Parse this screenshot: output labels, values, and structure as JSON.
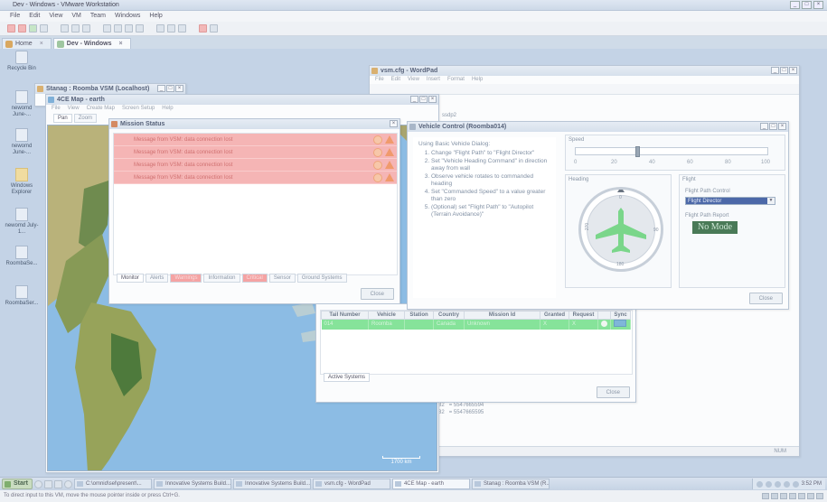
{
  "vmware": {
    "title": "Dev - Windows - VMware Workstation",
    "menu": [
      "File",
      "Edit",
      "View",
      "VM",
      "Team",
      "Windows",
      "Help"
    ],
    "tabs": [
      {
        "label": "Home"
      },
      {
        "label": "Dev - Windows"
      }
    ],
    "status": "To direct input to this VM, move the mouse pointer inside or press Ctrl+G."
  },
  "desktop_icons": [
    {
      "label": "Recycle Bin"
    },
    {
      "label": "newomd June-..."
    },
    {
      "label": "newomd June-..."
    },
    {
      "label": "Windows Explorer"
    },
    {
      "label": "newomd July-1..."
    },
    {
      "label": "RoombaSe..."
    },
    {
      "label": "RoombaSer..."
    }
  ],
  "wordpad": {
    "title": "vsm.cfg - WordPad",
    "menu": [
      "File",
      "Edit",
      "View",
      "Insert",
      "Format",
      "Help"
    ],
    "line1": "ssdp2",
    "line2": "82",
    "line3": "= 5547665594",
    "line4": "82",
    "line5": "= 5547665595",
    "status": "NUM"
  },
  "stanag": {
    "title": "Stanag : Roomba VSM (Localhost)"
  },
  "map_window": {
    "title": "4CE Map - earth",
    "menu": [
      "File",
      "View",
      "Create Map",
      "Screen Setup",
      "Help"
    ],
    "tool_tabs": [
      "Pan",
      "Zoom"
    ],
    "scale": "1700 km"
  },
  "mission_status": {
    "title": "Mission Status",
    "alerts": [
      {
        "text": "Message from VSM: data connection lost"
      },
      {
        "text": "Message from VSM: data connection lost"
      },
      {
        "text": "Message from VSM: data connection lost"
      },
      {
        "text": "Message from VSM: data connection lost"
      }
    ],
    "tabs": [
      {
        "label": "Monitor",
        "state": "sel"
      },
      {
        "label": "Alerts",
        "state": ""
      },
      {
        "label": "Warnings",
        "state": "hl"
      },
      {
        "label": "Information",
        "state": ""
      },
      {
        "label": "Critical",
        "state": "hl"
      },
      {
        "label": "Sensor",
        "state": ""
      },
      {
        "label": "Ground Systems",
        "state": ""
      }
    ],
    "close": "Close"
  },
  "vehicle_control": {
    "title": "Vehicle Control (Roomba014)",
    "intro": "Using Basic Vehicle Dialog:",
    "steps": [
      "Change \"Flight Path\" to \"Flight Director\"",
      "Set \"Vehicle Heading Command\" in direction away from wall",
      "Observe vehicle rotates to commanded heading",
      "Set \"Commanded Speed\" to a value greater than zero",
      "(Optional) set \"Flight Path\" to \"Autopilot (Terrain Avoidance)\""
    ],
    "speed_label": "Speed",
    "speed_ticks": [
      "0",
      "20",
      "40",
      "60",
      "80",
      "100"
    ],
    "speed_value": 0.32,
    "heading_label": "Heading",
    "compass_labels": {
      "n": "0",
      "e": "90",
      "s": "180",
      "w": "270"
    },
    "flight_label": "Flight",
    "flight_path_control_label": "Flight Path Control",
    "flight_path_control_value": "Flight Director",
    "flight_path_report_label": "Flight Path Report",
    "flight_path_report_value": "No Mode",
    "close": "Close"
  },
  "active_systems": {
    "columns": [
      "Tail Number",
      "Vehicle",
      "Station",
      "Country",
      "Mission Id",
      "Granted",
      "Request",
      "",
      "Sync"
    ],
    "rows": [
      {
        "tail": "014",
        "vehicle": "Roomba",
        "station": "",
        "country": "Canada",
        "mission": "Unknown",
        "granted": "X",
        "request": "X"
      }
    ],
    "tab": "Active Systems",
    "close": "Close"
  },
  "taskbar": {
    "start": "Start",
    "buttons": [
      "C:\\omnid\\sel\\present\\...",
      "Innovative Systems Build...",
      "Innovative Systems Build...",
      "vsm.cfg - WordPad",
      "4CE Map - earth",
      "Stanag : Roomba VSM (R..."
    ],
    "active_index": 4,
    "clock": "3:52 PM"
  },
  "colors": {
    "alert_red": "#f5b5b5",
    "active_green": "#86e39a",
    "nomode_bg": "#4a7a57",
    "desktop": "#c4d3e6",
    "ocean": "#8cbce4"
  }
}
